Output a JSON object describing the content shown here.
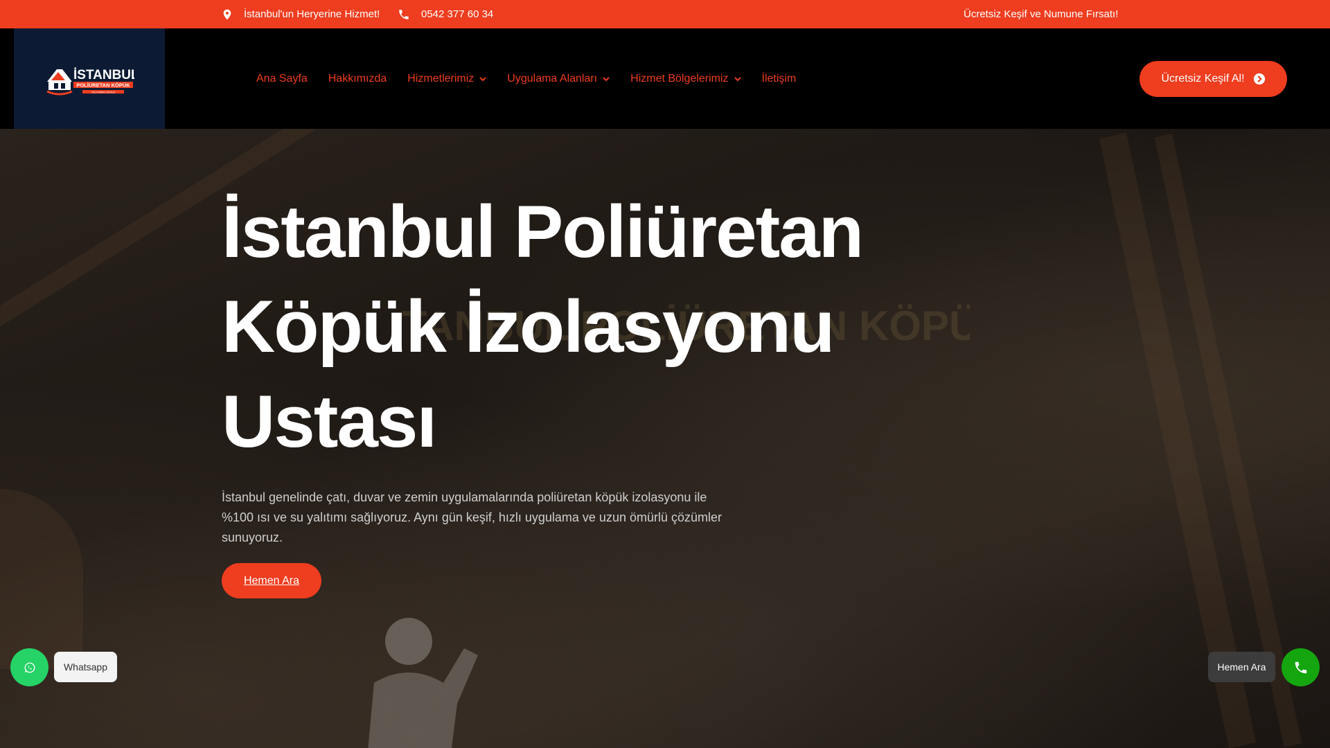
{
  "topbar": {
    "location_text": "İstanbul'un Heryerine Hizmet!",
    "phone_text": "0542 377 60 34",
    "promo_text": "Ücretsiz Keşif ve Numune Fırsatı!"
  },
  "logo": {
    "brand": "İSTANBUL",
    "subtitle": "POLİÜRETAN KÖPÜK",
    "tagline": "YALITIMIN USTASI"
  },
  "nav": {
    "items": [
      {
        "label": "Ana Sayfa"
      },
      {
        "label": "Hakkımızda"
      },
      {
        "label": "Hizmetlerimiz"
      },
      {
        "label": "Uygulama Alanları"
      },
      {
        "label": "Hizmet Bölgelerimiz"
      },
      {
        "label": "İletişim"
      }
    ],
    "cta_label": "Ücretsiz Keşif Al!"
  },
  "hero": {
    "title_lines": [
      "İstanbul Poliüretan",
      "Köpük İzolasyonu",
      "Ustası"
    ],
    "description": "İstanbul genelinde çatı, duvar ve zemin uygulamalarında poliüretan köpük izolasyonu ile %100 ısı ve su yalıtımı sağlıyoruz. Aynı gün keşif, hızlı uygulama ve uzun ömürlü çözümler sunuyoruz.",
    "button_label": "Hemen Ara",
    "background_lettering": "İSTANBUL POLİÜRETAN KÖPÜK"
  },
  "floating": {
    "whatsapp_label": "Whatsapp",
    "call_label": "Hemen Ara"
  },
  "colors": {
    "accent": "#ee3d1f",
    "header_bg": "#000000",
    "logo_bg": "#0c1a33",
    "whatsapp": "#25d366",
    "call": "#14a50f"
  },
  "icons": {
    "location": "map-pin-icon",
    "phone": "phone-icon",
    "dropdown": "chevron-down-icon",
    "cta": "arrow-circle-right-icon",
    "whatsapp": "whatsapp-icon"
  }
}
